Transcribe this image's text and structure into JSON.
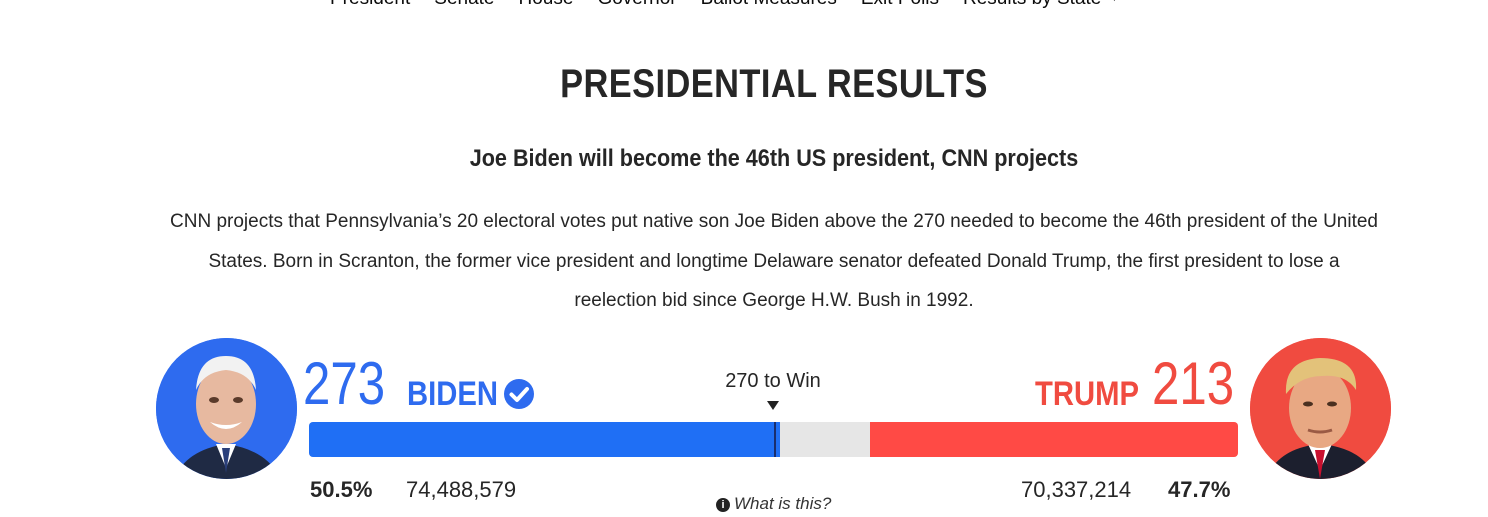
{
  "nav": {
    "items": [
      "President",
      "Senate",
      "House",
      "Governor",
      "Ballot Measures",
      "Exit Polls",
      "Results by State"
    ]
  },
  "header": {
    "title": "PRESIDENTIAL RESULTS",
    "subtitle": "Joe Biden will become the 46th US president, CNN projects",
    "body": "CNN projects that Pennsylvania’s 20 electoral votes put native son Joe Biden above the 270 needed to become the 46th president of the United States. Born in Scranton, the former vice president and longtime Delaware senator defeated Donald Trump, the first president to lose a reelection bid since George H.W. Bush in 1992."
  },
  "race": {
    "threshold_label": "270 to Win",
    "threshold": 270,
    "total_electoral_votes": 538,
    "what_is_this": "What is this?",
    "colors": {
      "democrat": "#1f6ff5",
      "republican": "#ff4a45",
      "uncalled": "#e6e6e6"
    },
    "biden": {
      "electoral_votes": "273",
      "electoral_votes_num": 273,
      "name": "BIDEN",
      "winner_icon": "check-circle-icon",
      "percent": "50.5%",
      "votes": "74,488,579"
    },
    "trump": {
      "electoral_votes": "213",
      "electoral_votes_num": 213,
      "name": "TRUMP",
      "percent": "47.7%",
      "votes": "70,337,214"
    }
  }
}
